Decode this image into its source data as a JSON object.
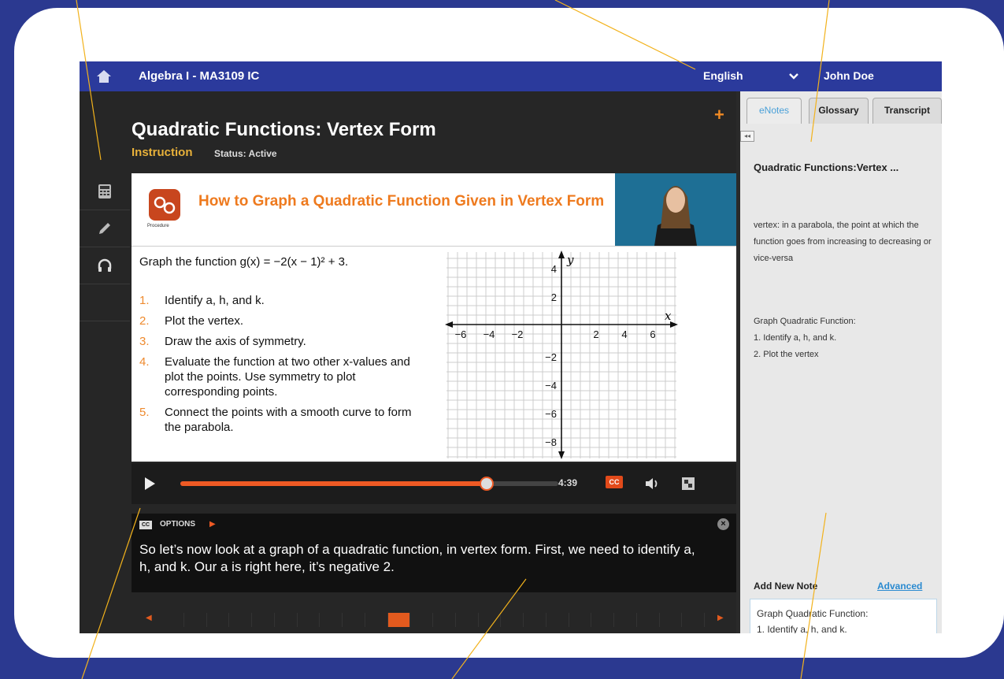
{
  "header": {
    "course_title": "Algebra I - MA3109 IC",
    "language": "English",
    "user_name": "John Doe"
  },
  "lesson": {
    "title": "Quadratic Functions: Vertex Form",
    "type": "Instruction",
    "status": "Status: Active"
  },
  "video": {
    "procedure_label": "Procedure",
    "title": "How to Graph a Quadratic Function Given in Vertex Form",
    "graph_prompt": "Graph the function g(x) = −2(x − 1)² + 3.",
    "steps": [
      {
        "num": "1.",
        "text": "Identify a, h, and k."
      },
      {
        "num": "2.",
        "text": "Plot the vertex."
      },
      {
        "num": "3.",
        "text": "Draw the axis of symmetry."
      },
      {
        "num": "4.",
        "text": "Evaluate the function at two other x-values and plot the points. Use symmetry to plot corresponding points."
      },
      {
        "num": "5.",
        "text": "Connect the points with a smooth curve to form the parabola."
      }
    ],
    "graph": {
      "x_label": "x",
      "y_label": "y",
      "x_ticks": [
        "−6",
        "−4",
        "−2",
        "2",
        "4",
        "6"
      ],
      "y_ticks": [
        "4",
        "2",
        "−2",
        "−4",
        "−6",
        "−8"
      ]
    }
  },
  "player": {
    "time": "4:39",
    "cc_label": "CC",
    "progress": 0.81
  },
  "captions": {
    "cc_label": "CC",
    "options_label": "OPTIONS",
    "text": "So let’s now look at a graph of a quadratic function, in vertex form. First, we need to identify a, h, and k. Our a is right here, it’s negative 2."
  },
  "timeline": {
    "cell_count": 24,
    "active_index": 10
  },
  "sidebar": {
    "tabs": [
      "eNotes",
      "Glossary",
      "Transcript"
    ],
    "active_tab": "eNotes",
    "collapse_label": "◂◂",
    "note_title": "Quadratic Functions:Vertex ...",
    "definition": "vertex: in a parabola, the point at which the function goes from increasing to decreasing or vice-versa",
    "list_title": "Graph Quadratic Function:",
    "list_items": [
      "1. Identify a, h, and k.",
      "2. Plot the vertex"
    ],
    "add_note_label": "Add New Note",
    "advanced_label": "Advanced",
    "new_note_line1": "Graph Quadratic Function:",
    "new_note_line2": "1. Identify a, h, and k."
  },
  "colors": {
    "frame": "#2b3990",
    "topbar": "#2b3a9c",
    "accent_orange": "#ee7a1e",
    "callout_line": "#f2b21c"
  }
}
